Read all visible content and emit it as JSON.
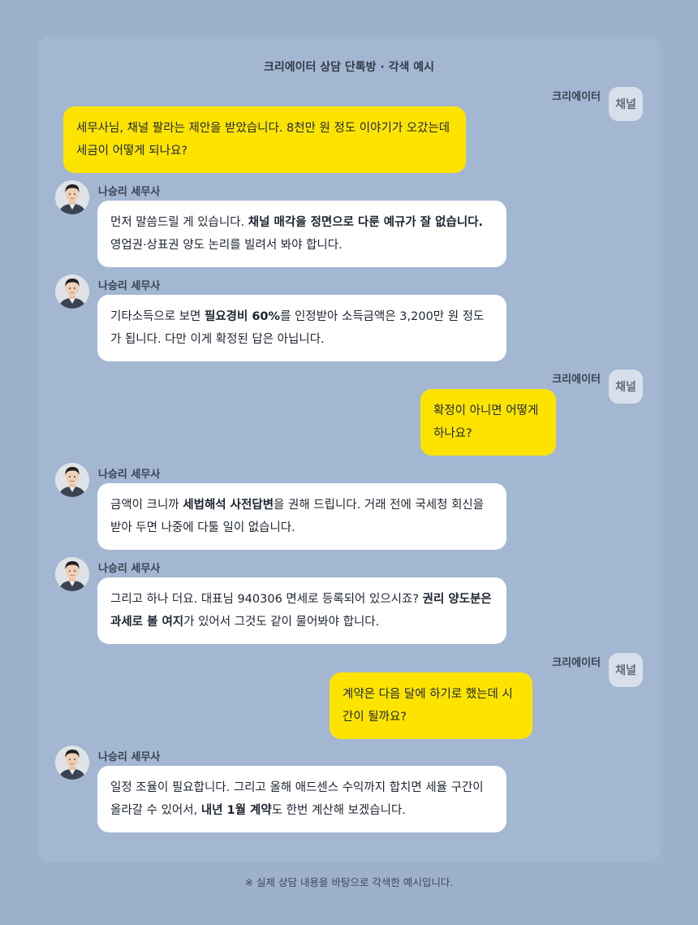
{
  "title": "크리에이터 상담 단톡방 · 각색 예시",
  "footer": "※ 실제 상담 내용을 바탕으로 각색한 예시입니다.",
  "creator": {
    "name": "크리에이터",
    "avatar_label": "채널"
  },
  "advisor": {
    "name": "나승리 세무사",
    "avatar": "advisor-portrait-icon"
  },
  "colors": {
    "background": "#9db1cd",
    "panel": "#a3b7d2",
    "creator_bubble": "#fde400",
    "advisor_bubble": "#ffffff"
  },
  "messages": [
    {
      "from": "creator",
      "parts": [
        {
          "t": "세무사님, 채널 팔라는 제안을 받았습니다. 8천만 원 정도 이야기가 오갔는데 세금이 어떻게 되나요?"
        }
      ]
    },
    {
      "from": "advisor",
      "parts": [
        {
          "t": "먼저 말씀드릴 게 있습니다. "
        },
        {
          "t": "채널 매각을 정면으로 다룬 예규가 잘 없습니다.",
          "b": true
        },
        {
          "t": " 영업권·상표권 양도 논리를 빌려서 봐야 합니다."
        }
      ]
    },
    {
      "from": "advisor",
      "parts": [
        {
          "t": "기타소득으로 보면 "
        },
        {
          "t": "필요경비 60%",
          "b": true
        },
        {
          "t": "를 인정받아 소득금액은 3,200만 원 정도가 됩니다. 다만 이게 확정된 답은 아닙니다."
        }
      ]
    },
    {
      "from": "creator",
      "parts": [
        {
          "t": "확정이 아니면 어떻게 하나요?"
        }
      ]
    },
    {
      "from": "advisor",
      "parts": [
        {
          "t": "금액이 크니까 "
        },
        {
          "t": "세법해석 사전답변",
          "b": true
        },
        {
          "t": "을 권해 드립니다. 거래 전에 국세청 회신을 받아 두면 나중에 다툴 일이 없습니다."
        }
      ]
    },
    {
      "from": "advisor",
      "parts": [
        {
          "t": "그리고 하나 더요. 대표님 940306 면세로 등록되어 있으시죠? "
        },
        {
          "t": "권리 양도분은 과세로 볼 여지",
          "b": true
        },
        {
          "t": "가 있어서 그것도 같이 물어봐야 합니다."
        }
      ]
    },
    {
      "from": "creator",
      "parts": [
        {
          "t": "계약은 다음 달에 하기로 했는데 시간이 될까요?"
        }
      ]
    },
    {
      "from": "advisor",
      "parts": [
        {
          "t": "일정 조율이 필요합니다. 그리고 올해 애드센스 수익까지 합치면 세율 구간이 올라갈 수 있어서, "
        },
        {
          "t": "내년 1월 계약",
          "b": true
        },
        {
          "t": "도 한번 계산해 보겠습니다."
        }
      ]
    }
  ]
}
